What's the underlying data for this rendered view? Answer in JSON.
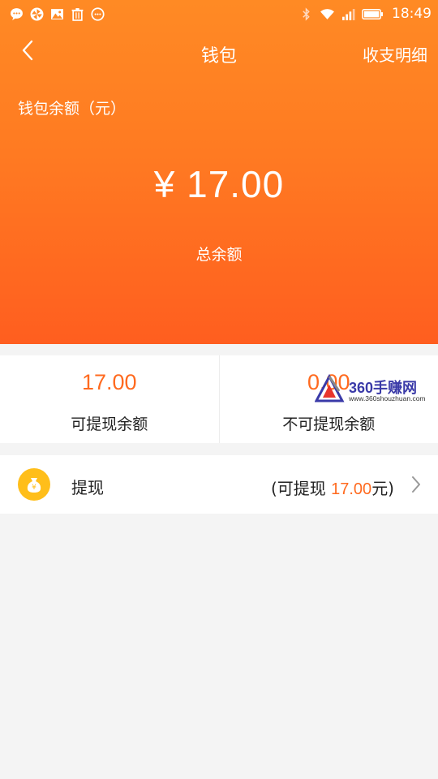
{
  "status_bar": {
    "time": "18:49",
    "left_icons": [
      "chat-icon",
      "pinwheel-icon",
      "image-icon",
      "trash-icon",
      "emoji-icon"
    ],
    "right_icons": [
      "bluetooth-icon",
      "wifi-icon",
      "signal-icon",
      "battery-icon"
    ]
  },
  "nav": {
    "title": "钱包",
    "right_link": "收支明细"
  },
  "balance": {
    "label": "钱包余额（元）",
    "amount": "¥ 17.00",
    "total_label": "总余额"
  },
  "summary": {
    "withdrawable_value": "17.00",
    "withdrawable_label": "可提现余额",
    "non_withdrawable_value": "0.00",
    "non_withdrawable_label": "不可提现余额"
  },
  "watermark": {
    "text": "360手赚网",
    "url": "www.360shouzhuan.com"
  },
  "withdraw": {
    "label": "提现",
    "info_prefix": "(可提现 ",
    "info_amount": "17.00",
    "info_suffix": "元)"
  },
  "colors": {
    "header_top": "#ff8a24",
    "header_bottom": "#ff5e1f",
    "accent": "#ff6a1f",
    "coin": "#ffbe1a",
    "background": "#f4f4f4"
  }
}
